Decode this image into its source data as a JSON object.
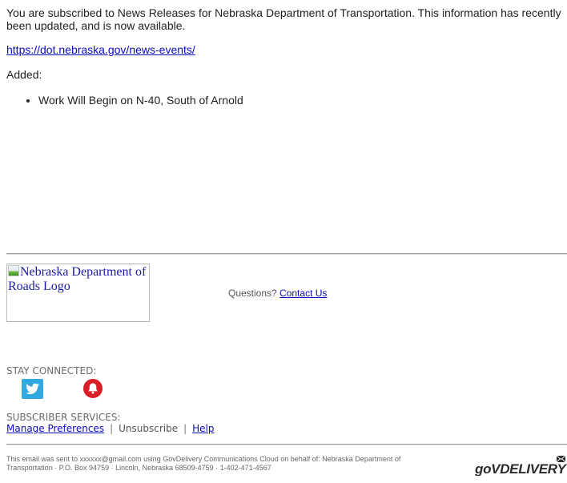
{
  "email": {
    "intro_text": "You are subscribed to News Releases for Nebraska Department of Transportation. This information has recently been updated, and is now available.",
    "main_link": "https://dot.nebraska.gov/news-events/",
    "added_label": "Added:",
    "added_items": [
      "Work Will Begin on N-40, South of Arnold"
    ]
  },
  "footer": {
    "logo_alt": "Nebraska Department of Roads Logo",
    "questions_label": "Questions?",
    "contact_link": "Contact Us",
    "stay_connected_label": "STAY CONNECTED:",
    "social_icons": [
      "twitter-icon",
      "alert-bell-icon"
    ],
    "subscriber_services_label": "SUBSCRIBER SERVICES:",
    "manage_preferences": "Manage Preferences",
    "separator": "|",
    "unsubscribe": "Unsubscribe",
    "help": "Help",
    "disclaimer_line1": "This email was sent to xxxxxx@gmail.com using GovDelivery Communications Cloud on behalf of: Nebraska Department of",
    "disclaimer_line2": "Transportation · P.O. Box 94759 · Lincoln, Nebraska 68509-4759 · 1-402-471-4567",
    "brand_logo_text": "GOVDELIVERY"
  },
  "colors": {
    "link": "#0b0bbf",
    "twitter": "#32a8e0",
    "alert": "#d91f26"
  }
}
